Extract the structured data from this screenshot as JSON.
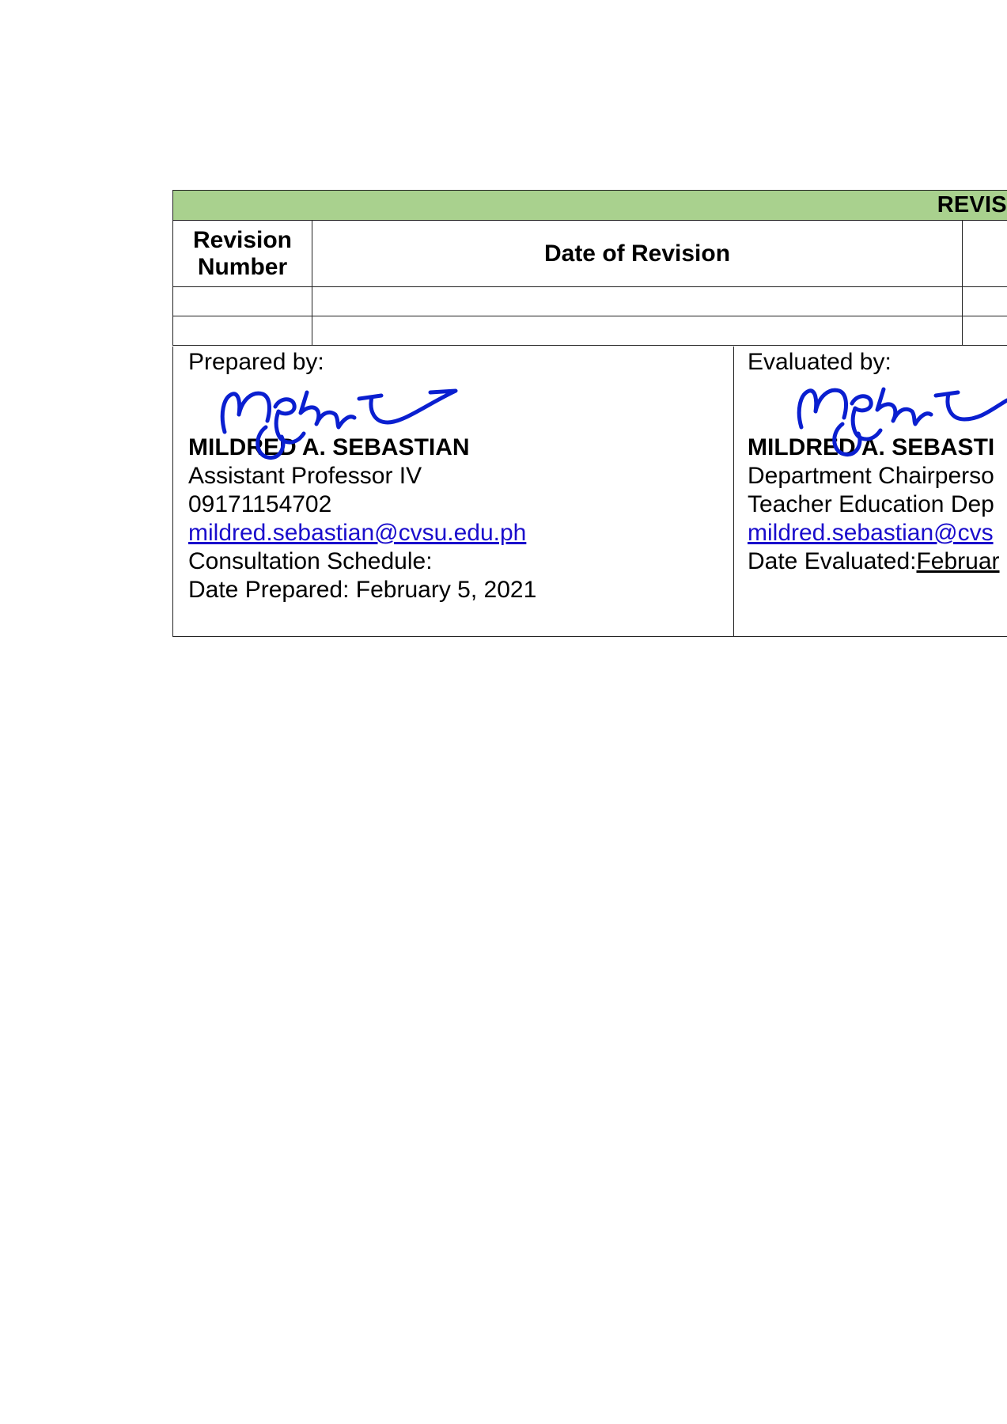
{
  "revision_history": {
    "title": "REVISION HIST",
    "columns": [
      "Revision Number",
      "Date of Revision"
    ],
    "column_labels": {
      "revision_number_line1": "Revision",
      "revision_number_line2": "Number",
      "date_of_revision": "Date of Revision"
    },
    "rows": [
      [
        "",
        "",
        ""
      ],
      [
        "",
        "",
        ""
      ]
    ],
    "header_color": "#a9d18e"
  },
  "prepared": {
    "label": "Prepared by:",
    "name": "MILDRED A. SEBASTIAN",
    "position": "Assistant Professor IV",
    "phone": "09171154702",
    "email": "mildred.sebastian@cvsu.edu.ph",
    "consultation_label": "Consultation Schedule:",
    "date_line": "Date Prepared: February 5, 2021"
  },
  "evaluated": {
    "label": "Evaluated by:",
    "name": "MILDRED A. SEBASTI",
    "position": "Department Chairperso",
    "department": "Teacher Education Dep",
    "email": "mildred.sebastian@cvs",
    "date_label": "Date Evaluated:",
    "date_value": "Februar"
  },
  "signature_ink_color": "#0a1fd0",
  "link_color": "#1a0dcc"
}
